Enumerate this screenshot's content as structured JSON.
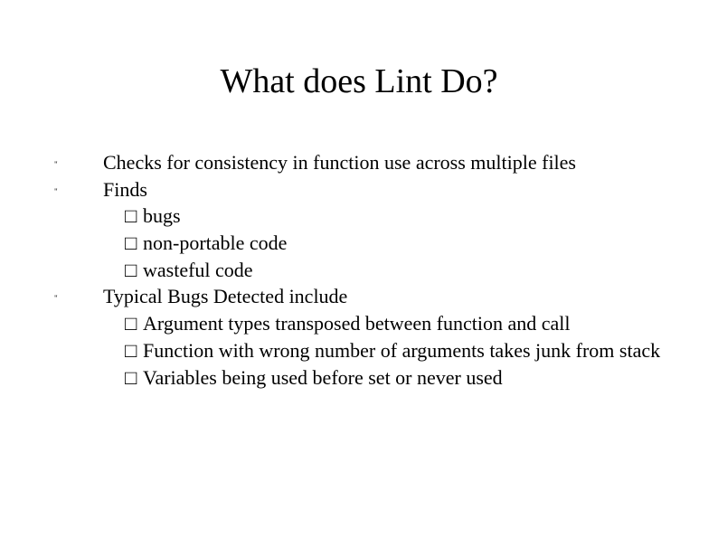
{
  "title": "What does Lint Do?",
  "mark_box": "□",
  "mark_bullet": "\"",
  "items": [
    {
      "text": "Checks for consistency in function use across multiple files",
      "subs": []
    },
    {
      "text": "Finds",
      "subs": [
        {
          "text": "bugs"
        },
        {
          "text": "non-portable code"
        },
        {
          "text": "wasteful code"
        }
      ]
    },
    {
      "text": "Typical Bugs Detected include",
      "subs": [
        {
          "text": "Argument types transposed between function and call"
        },
        {
          "text": "Function with wrong number of arguments takes junk from stack"
        },
        {
          "text": "Variables being used before set or never used"
        }
      ]
    }
  ]
}
